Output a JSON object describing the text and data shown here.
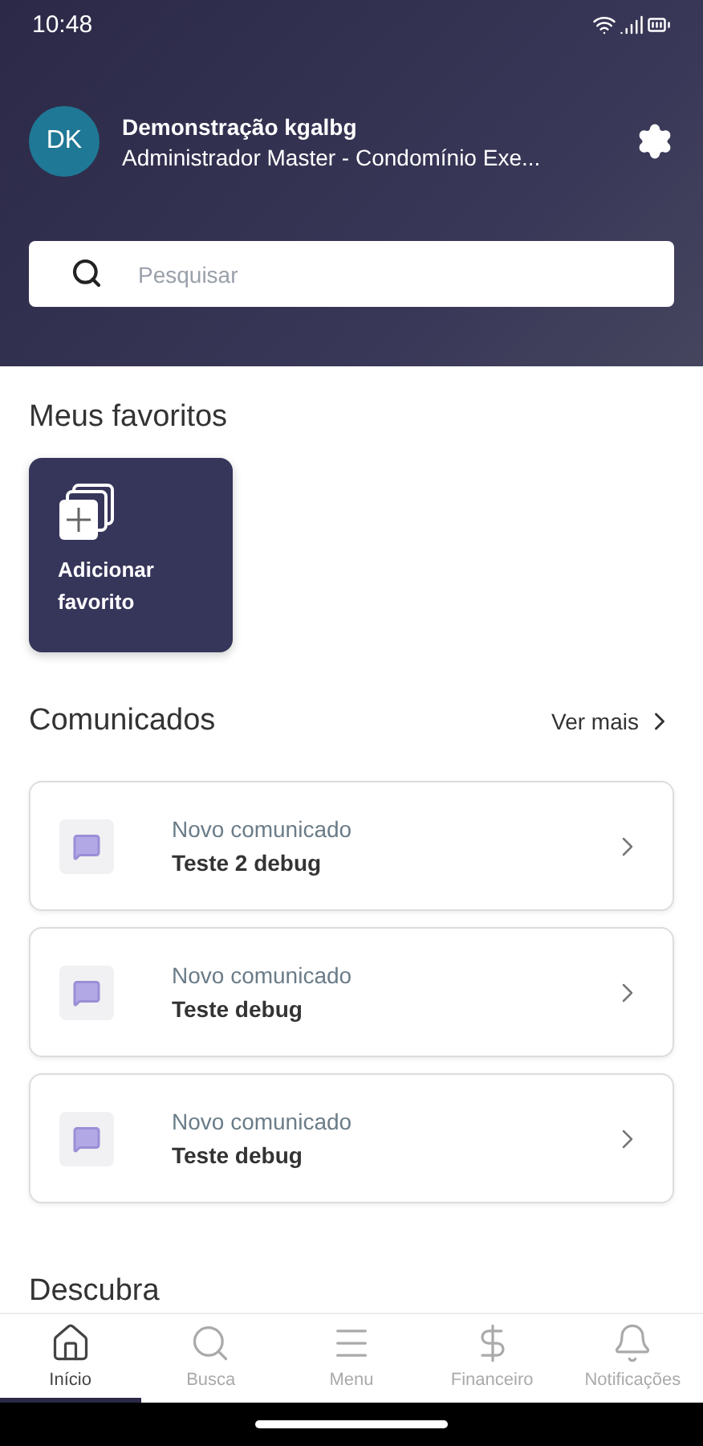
{
  "status_bar": {
    "time": "10:48"
  },
  "profile": {
    "initials": "DK",
    "name": "Demonstração kgalbg",
    "role": "Administrador Master - Condomínio Exe..."
  },
  "search": {
    "placeholder": "Pesquisar"
  },
  "favorites": {
    "title": "Meus favoritos",
    "add_label": "Adicionar favorito"
  },
  "announcements": {
    "title": "Comunicados",
    "more": "Ver mais",
    "items": [
      {
        "label": "Novo comunicado",
        "title": "Teste 2 debug"
      },
      {
        "label": "Novo comunicado",
        "title": "Teste debug"
      },
      {
        "label": "Novo comunicado",
        "title": "Teste debug"
      }
    ]
  },
  "next_section": {
    "title": "Descubra"
  },
  "nav": [
    {
      "kind": "home",
      "label": "Início",
      "selected": true
    },
    {
      "kind": "search",
      "label": "Busca",
      "selected": false
    },
    {
      "kind": "menu",
      "label": "Menu",
      "selected": false
    },
    {
      "kind": "money",
      "label": "Financeiro",
      "selected": false
    },
    {
      "kind": "bell",
      "label": "Notificações",
      "selected": false
    }
  ]
}
